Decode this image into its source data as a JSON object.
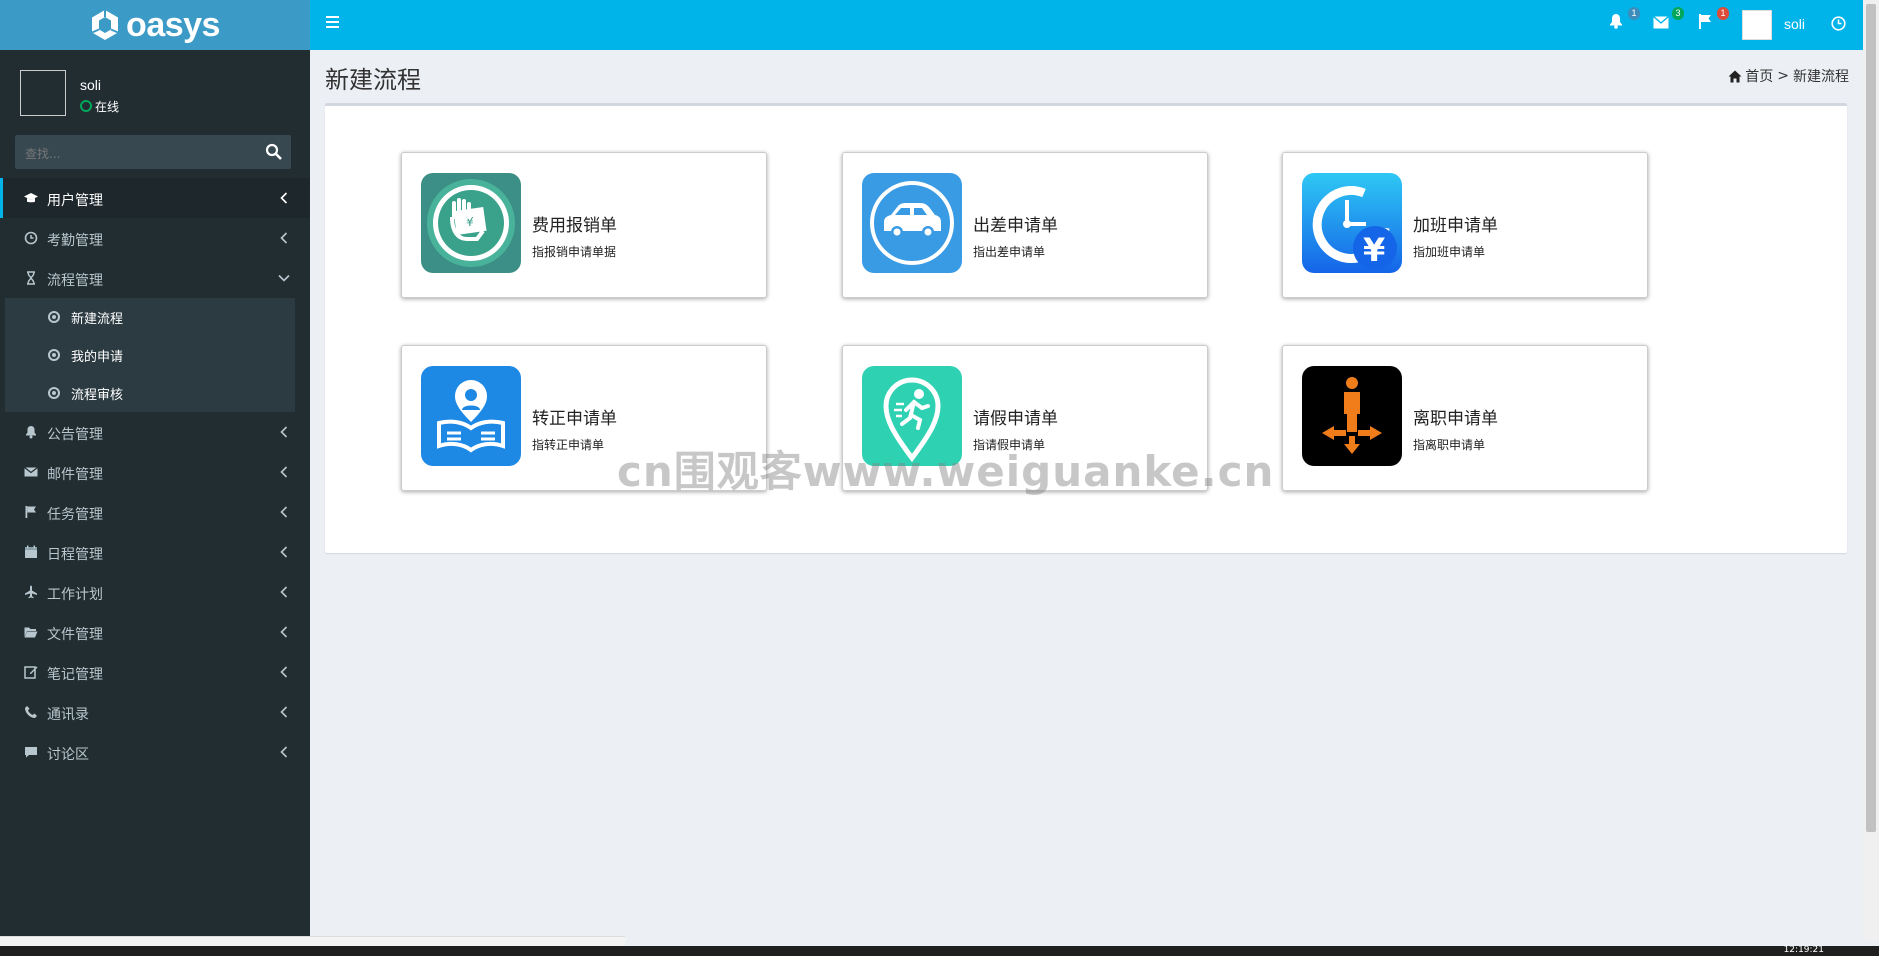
{
  "app": {
    "logo_text": "oasys"
  },
  "topbar": {
    "notifications": {
      "icon": "bell-icon",
      "count": "1",
      "color": "#3c8dbc"
    },
    "messages": {
      "icon": "envelope-icon",
      "count": "3",
      "color": "#00a65a"
    },
    "flags": {
      "icon": "flag-icon",
      "count": "1",
      "color": "#dd4b39"
    },
    "user_name": "soli"
  },
  "sidebar": {
    "user": {
      "name": "soli",
      "status": "在线"
    },
    "search": {
      "placeholder": "查找..."
    },
    "menu": [
      {
        "label": "用户管理",
        "icon": "graduation-cap-icon",
        "active": true
      },
      {
        "label": "考勤管理",
        "icon": "clock-icon"
      },
      {
        "label": "流程管理",
        "icon": "hourglass-icon",
        "expanded": true,
        "children": [
          {
            "label": "新建流程"
          },
          {
            "label": "我的申请"
          },
          {
            "label": "流程审核"
          }
        ]
      },
      {
        "label": "公告管理",
        "icon": "bell-icon"
      },
      {
        "label": "邮件管理",
        "icon": "envelope-icon"
      },
      {
        "label": "任务管理",
        "icon": "flag-icon"
      },
      {
        "label": "日程管理",
        "icon": "calendar-icon"
      },
      {
        "label": "工作计划",
        "icon": "plane-icon"
      },
      {
        "label": "文件管理",
        "icon": "folder-open-icon"
      },
      {
        "label": "笔记管理",
        "icon": "edit-icon"
      },
      {
        "label": "通讯录",
        "icon": "phone-icon"
      },
      {
        "label": "讨论区",
        "icon": "comment-icon"
      }
    ]
  },
  "header": {
    "title": "新建流程",
    "breadcrumb_home": "首页",
    "breadcrumb_sep": ">",
    "breadcrumb_current": "新建流程"
  },
  "cards": [
    {
      "title": "费用报销单",
      "desc": "指报销申请单据",
      "icon": "reimbursement-icon",
      "color": "#3aa18a"
    },
    {
      "title": "出差申请单",
      "desc": "指出差申请单",
      "icon": "car-icon",
      "color": "#3a9be5"
    },
    {
      "title": "加班申请单",
      "desc": "指加班申请单",
      "icon": "overtime-clock-icon",
      "color": "#1e88f0"
    },
    {
      "title": "转正申请单",
      "desc": "指转正申请单",
      "icon": "person-book-icon",
      "color": "#1e88e5"
    },
    {
      "title": "请假申请单",
      "desc": "指请假申请单",
      "icon": "runner-pin-icon",
      "color": "#2fd1b3"
    },
    {
      "title": "离职申请单",
      "desc": "指离职申请单",
      "icon": "person-exit-icon",
      "color": "#000000"
    }
  ],
  "watermark": "cn围观客www.weiguanke.cn",
  "taskbar": {
    "time": "12:19:21"
  }
}
